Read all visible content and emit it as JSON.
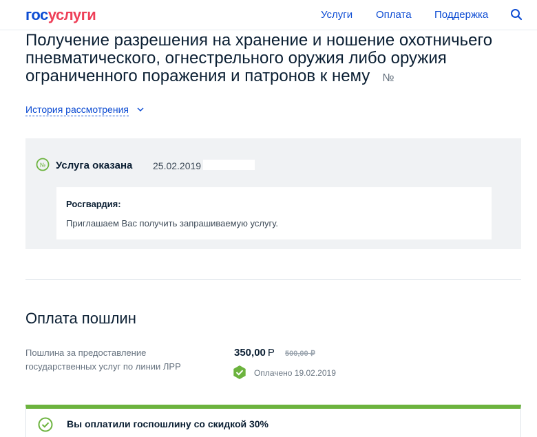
{
  "header": {
    "logo_part1": "гос",
    "logo_part2": "услуги",
    "nav": [
      "Услуги",
      "Оплата",
      "Поддержка"
    ]
  },
  "page": {
    "title": "Получение разрешения на хранение и ношение охотничьего пневматического, огнестрельного оружия либо оружия ограниченного поражения и патронов к нему",
    "number_sign": "№",
    "history_link": "История рассмотрения"
  },
  "status": {
    "label": "Услуга оказана",
    "date": "25.02.2019",
    "message": {
      "org": "Росгвардия:",
      "text": "Приглашаем Вас получить запрашиваемую услугу."
    }
  },
  "payment": {
    "title": "Оплата пошлин",
    "fee_description": "Пошлина за предоставление государственных услуг по линии ЛРР",
    "price": "350,00",
    "currency": "Р",
    "old_price": "500,00 ₽",
    "paid_status": "Оплачено 19.02.2019",
    "discount_notice": "Вы оплатили госпошлину со скидкой 30%"
  },
  "colors": {
    "brand_blue": "#0d4cd3",
    "brand_red": "#ee3f58",
    "success_green": "#6cb33e"
  }
}
